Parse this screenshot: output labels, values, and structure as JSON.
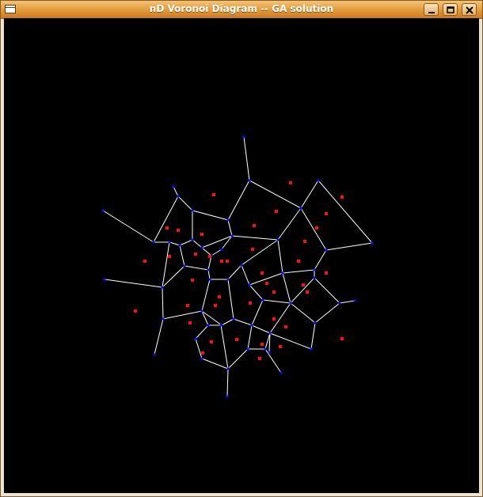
{
  "window": {
    "title": "nD Voronoi Diagram -- GA solution",
    "buttons": {
      "minimize": "minimize",
      "maximize": "maximize",
      "close": "close"
    }
  },
  "colors": {
    "background": "#000000",
    "edge": "#ffffff",
    "vertex": "#1010ff",
    "site": "#ff1010",
    "titlebar": "#e09a36"
  }
}
